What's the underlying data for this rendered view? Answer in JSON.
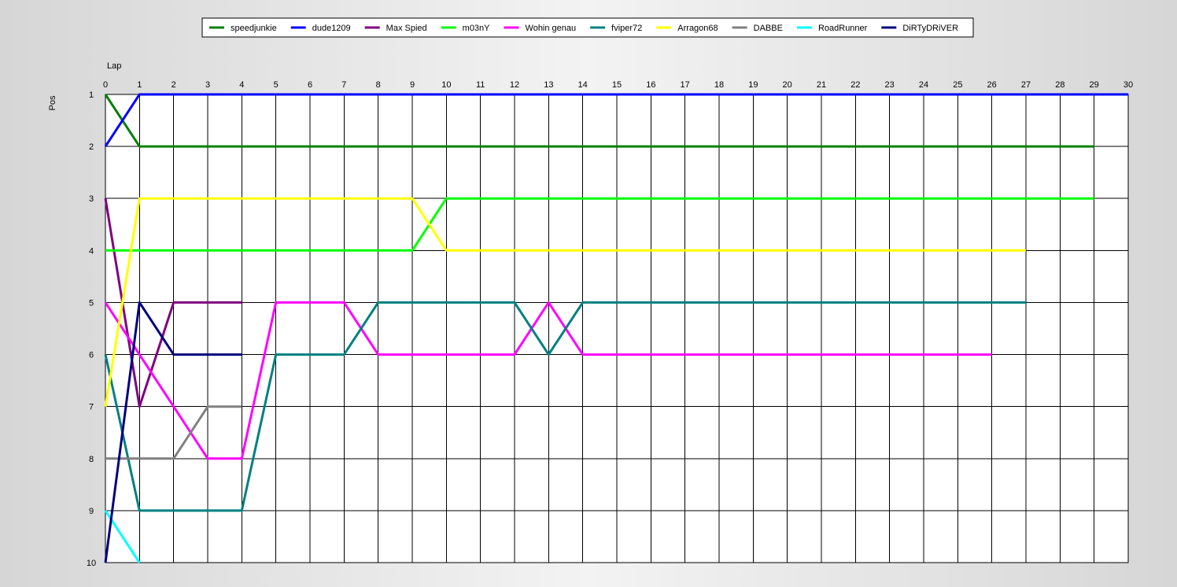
{
  "chart_data": {
    "type": "line",
    "xlabel": "Lap",
    "ylabel": "Pos",
    "xlim": [
      0,
      30
    ],
    "ylim": [
      1,
      10
    ],
    "y_inverted": true,
    "grid": true,
    "legend_placement": "top-center",
    "x_ticks": [
      0,
      1,
      2,
      3,
      4,
      5,
      6,
      7,
      8,
      9,
      10,
      11,
      12,
      13,
      14,
      15,
      16,
      17,
      18,
      19,
      20,
      21,
      22,
      23,
      24,
      25,
      26,
      27,
      28,
      29,
      30
    ],
    "y_ticks": [
      1,
      2,
      3,
      4,
      5,
      6,
      7,
      8,
      9,
      10
    ],
    "series": [
      {
        "name": "speedjunkie",
        "color": "#008000",
        "x": [
          0,
          1,
          2,
          3,
          4,
          5,
          6,
          7,
          8,
          9,
          10,
          11,
          12,
          13,
          14,
          15,
          16,
          17,
          18,
          19,
          20,
          21,
          22,
          23,
          24,
          25,
          26,
          27,
          28,
          29
        ],
        "y": [
          1,
          2,
          2,
          2,
          2,
          2,
          2,
          2,
          2,
          2,
          2,
          2,
          2,
          2,
          2,
          2,
          2,
          2,
          2,
          2,
          2,
          2,
          2,
          2,
          2,
          2,
          2,
          2,
          2,
          2
        ]
      },
      {
        "name": "dude1209",
        "color": "#0000ff",
        "x": [
          0,
          1,
          2,
          3,
          4,
          5,
          6,
          7,
          8,
          9,
          10,
          11,
          12,
          13,
          14,
          15,
          16,
          17,
          18,
          19,
          20,
          21,
          22,
          23,
          24,
          25,
          26,
          27,
          28,
          29,
          30
        ],
        "y": [
          2,
          1,
          1,
          1,
          1,
          1,
          1,
          1,
          1,
          1,
          1,
          1,
          1,
          1,
          1,
          1,
          1,
          1,
          1,
          1,
          1,
          1,
          1,
          1,
          1,
          1,
          1,
          1,
          1,
          1,
          1
        ]
      },
      {
        "name": "Max Spied",
        "color": "#800080",
        "x": [
          0,
          1,
          2,
          3,
          4
        ],
        "y": [
          3,
          7,
          5,
          5,
          5
        ]
      },
      {
        "name": "m03nY",
        "color": "#00ff00",
        "x": [
          0,
          1,
          2,
          3,
          4,
          5,
          6,
          7,
          8,
          9,
          10,
          11,
          12,
          13,
          14,
          15,
          16,
          17,
          18,
          19,
          20,
          21,
          22,
          23,
          24,
          25,
          26,
          27,
          28,
          29
        ],
        "y": [
          4,
          4,
          4,
          4,
          4,
          4,
          4,
          4,
          4,
          4,
          3,
          3,
          3,
          3,
          3,
          3,
          3,
          3,
          3,
          3,
          3,
          3,
          3,
          3,
          3,
          3,
          3,
          3,
          3,
          3
        ]
      },
      {
        "name": "Wohin genau",
        "color": "#ff00ff",
        "x": [
          0,
          1,
          2,
          3,
          4,
          5,
          6,
          7,
          8,
          9,
          10,
          11,
          12,
          13,
          14,
          15,
          16,
          17,
          18,
          19,
          20,
          21,
          22,
          23,
          24,
          25,
          26
        ],
        "y": [
          5,
          6,
          7,
          8,
          8,
          5,
          5,
          5,
          6,
          6,
          6,
          6,
          6,
          5,
          6,
          6,
          6,
          6,
          6,
          6,
          6,
          6,
          6,
          6,
          6,
          6,
          6
        ]
      },
      {
        "name": "fviper72",
        "color": "#008080",
        "x": [
          0,
          1,
          2,
          3,
          4,
          5,
          6,
          7,
          8,
          9,
          10,
          11,
          12,
          13,
          14,
          15,
          16,
          17,
          18,
          19,
          20,
          21,
          22,
          23,
          24,
          25,
          26,
          27
        ],
        "y": [
          6,
          9,
          9,
          9,
          9,
          6,
          6,
          6,
          5,
          5,
          5,
          5,
          5,
          6,
          5,
          5,
          5,
          5,
          5,
          5,
          5,
          5,
          5,
          5,
          5,
          5,
          5,
          5
        ]
      },
      {
        "name": "Arragon68",
        "color": "#ffff00",
        "x": [
          0,
          1,
          2,
          3,
          4,
          5,
          6,
          7,
          8,
          9,
          10,
          11,
          12,
          13,
          14,
          15,
          16,
          17,
          18,
          19,
          20,
          21,
          22,
          23,
          24,
          25,
          26,
          27
        ],
        "y": [
          7,
          3,
          3,
          3,
          3,
          3,
          3,
          3,
          3,
          3,
          4,
          4,
          4,
          4,
          4,
          4,
          4,
          4,
          4,
          4,
          4,
          4,
          4,
          4,
          4,
          4,
          4,
          4
        ]
      },
      {
        "name": "DABBE",
        "color": "#808080",
        "x": [
          0,
          1,
          2,
          3,
          4
        ],
        "y": [
          8,
          8,
          8,
          7,
          7
        ]
      },
      {
        "name": "RoadRunner",
        "color": "#00ffff",
        "x": [
          0,
          1
        ],
        "y": [
          9,
          10
        ]
      },
      {
        "name": "DiRTyDRiVER",
        "color": "#000080",
        "x": [
          0,
          1,
          2,
          3,
          4
        ],
        "y": [
          10,
          5,
          6,
          6,
          6
        ]
      }
    ]
  }
}
